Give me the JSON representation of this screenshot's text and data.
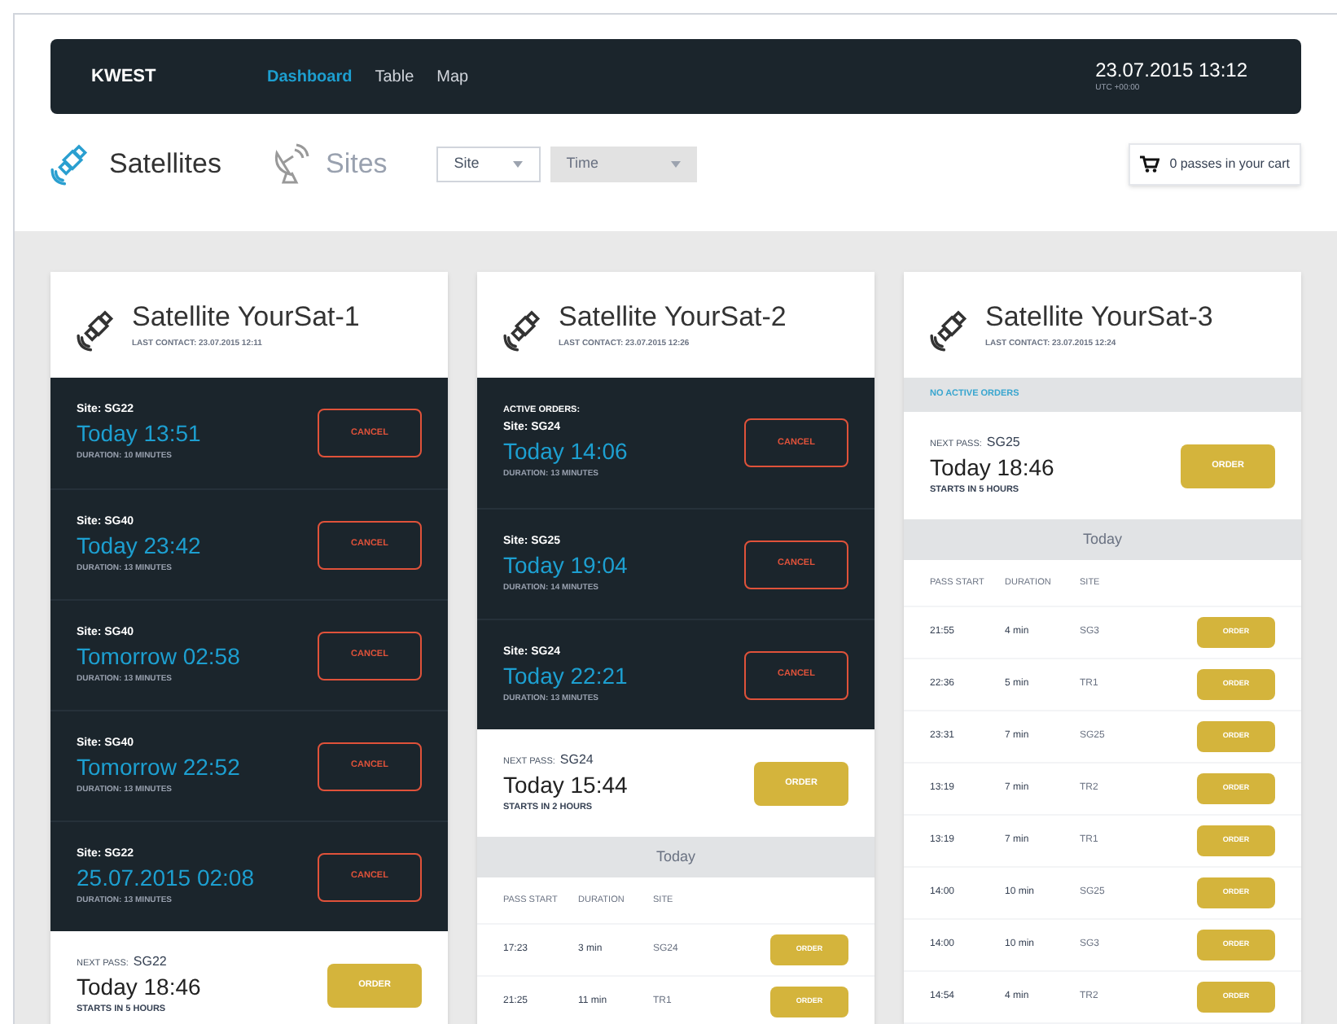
{
  "nav": {
    "brand": "KWEST",
    "links": [
      {
        "label": "Dashboard",
        "selected": true
      },
      {
        "label": "Table",
        "selected": false
      },
      {
        "label": "Map",
        "selected": false
      }
    ],
    "datetime": "23.07.2015 13:12",
    "timezone": "UTC +00:00"
  },
  "views": [
    {
      "label": "Satellites",
      "selected": true,
      "kind": "satellite"
    },
    {
      "label": "Sites",
      "selected": false,
      "kind": "dish"
    }
  ],
  "filters": [
    {
      "label": "Site",
      "disabled": false
    },
    {
      "label": "Time",
      "disabled": true
    }
  ],
  "cart": {
    "text": "0 passes in your cart"
  },
  "satellites": [
    {
      "title": "Satellite YourSat-1",
      "last_contact": "LAST CONTACT: 23.07.2015 12:11",
      "orders": [
        {
          "site": "Site: SG22",
          "time": "Today 13:51",
          "duration": "DURATION: 10 MINUTES",
          "action": "CANCEL"
        },
        {
          "site": "Site: SG40",
          "time": "Today 23:42",
          "duration": "DURATION: 13 MINUTES",
          "action": "CANCEL"
        },
        {
          "site": "Site: SG40",
          "time": "Tomorrow 02:58",
          "duration": "DURATION: 13 MINUTES",
          "action": "CANCEL"
        },
        {
          "site": "Site: SG40",
          "time": "Tomorrow 22:52",
          "duration": "DURATION: 13 MINUTES",
          "action": "CANCEL"
        },
        {
          "site": "Site: SG22",
          "time": "25.07.2015 02:08",
          "duration": "DURATION: 13 MINUTES",
          "action": "CANCEL"
        }
      ],
      "next_pass": {
        "label": "NEXT PASS:",
        "site": "SG22",
        "time": "Today 18:46",
        "starts": "STARTS IN 5 HOURS",
        "action": "ORDER"
      }
    },
    {
      "title": "Satellite YourSat-2",
      "last_contact": "LAST CONTACT: 23.07.2015 12:26",
      "orders_label": "ACTIVE ORDERS:",
      "orders": [
        {
          "site": "Site: SG24",
          "time": "Today 14:06",
          "duration": "DURATION: 13 MINUTES",
          "action": "CANCEL"
        },
        {
          "site": "Site: SG25",
          "time": "Today 19:04",
          "duration": "DURATION: 14 MINUTES",
          "action": "CANCEL"
        },
        {
          "site": "Site: SG24",
          "time": "Today 22:21",
          "duration": "DURATION: 13 MINUTES",
          "action": "CANCEL"
        }
      ],
      "next_pass": {
        "label": "NEXT PASS:",
        "site": "SG24",
        "time": "Today 15:44",
        "starts": "STARTS IN 2 HOURS",
        "action": "ORDER"
      },
      "day_label": "Today",
      "columns": [
        "PASS START",
        "DURATION",
        "SITE"
      ],
      "passes": [
        {
          "start": "17:23",
          "duration": "3 min",
          "site": "SG24",
          "action": "ORDER"
        },
        {
          "start": "21:25",
          "duration": "11 min",
          "site": "TR1",
          "action": "ORDER"
        }
      ]
    },
    {
      "title": "Satellite YourSat-3",
      "last_contact": "LAST CONTACT: 23.07.2015 12:24",
      "no_orders": "NO ACTIVE ORDERS",
      "next_pass": {
        "label": "NEXT PASS:",
        "site": "SG25",
        "time": "Today 18:46",
        "starts": "STARTS IN 5 HOURS",
        "action": "ORDER"
      },
      "day_label": "Today",
      "columns": [
        "PASS START",
        "DURATION",
        "SITE"
      ],
      "passes": [
        {
          "start": "21:55",
          "duration": "4 min",
          "site": "SG3",
          "action": "ORDER"
        },
        {
          "start": "22:36",
          "duration": "5 min",
          "site": "TR1",
          "action": "ORDER"
        },
        {
          "start": "23:31",
          "duration": "7 min",
          "site": "SG25",
          "action": "ORDER"
        },
        {
          "start": "13:19",
          "duration": "7 min",
          "site": "TR2",
          "action": "ORDER"
        },
        {
          "start": "13:19",
          "duration": "7 min",
          "site": "TR1",
          "action": "ORDER"
        },
        {
          "start": "14:00",
          "duration": "10 min",
          "site": "SG25",
          "action": "ORDER"
        },
        {
          "start": "14:00",
          "duration": "10 min",
          "site": "SG3",
          "action": "ORDER"
        },
        {
          "start": "14:54",
          "duration": "4 min",
          "site": "TR2",
          "action": "ORDER"
        }
      ]
    }
  ]
}
